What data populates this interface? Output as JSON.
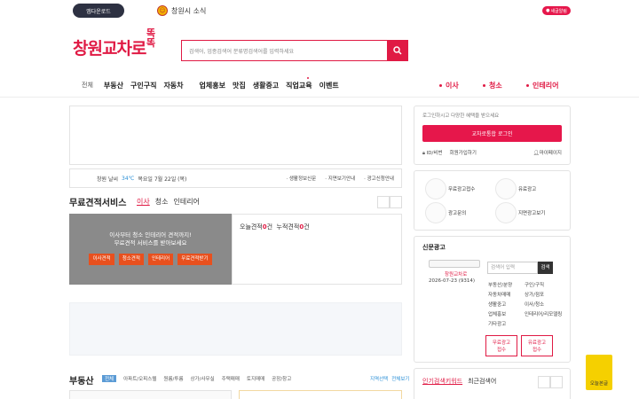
{
  "top": {
    "left_button": "앱다운로드",
    "promo_text": "창원시 소식",
    "right_pill": "새글알림"
  },
  "logo": {
    "main": "창원교차로",
    "badge_line1": "똑",
    "badge_line2": "똑"
  },
  "search": {
    "placeholder": "검색어, 업종검색어 분류명검색어를 입력하세요"
  },
  "nav": {
    "items": [
      "전체",
      "부동산",
      "구인구직",
      "자동차",
      "업체홍보",
      "맛집",
      "생활중고",
      "직업교육",
      "이벤트"
    ],
    "right": [
      "이사",
      "청소",
      "인테리어"
    ]
  },
  "weather": {
    "location": "창원 날씨",
    "temp": "34℃",
    "date": "목요일 7월 22일 (목)",
    "links": [
      "생활정보신문",
      "지면보기안내",
      "광고신청안내"
    ]
  },
  "quote": {
    "title": "무료견적서비스",
    "tabs": [
      "이사",
      "청소",
      "인테리어"
    ],
    "image_line1": "이사부터 청소 인테리어 견적까지!",
    "image_line2": "무료견적 서비스를 받아보세요",
    "image_buttons": [
      "이사견적",
      "청소견적",
      "인테리어",
      "무료견적받기"
    ],
    "count_label1": "오늘견적",
    "count_value1": "0",
    "count_unit1": "건",
    "count_label2": "누적견적",
    "count_value2": "0",
    "count_unit2": "건"
  },
  "realestate": {
    "title": "부동산",
    "tabs": [
      "전체",
      "아파트/오피스텔",
      "원룸/투룸",
      "상가/사무실",
      "주택매매",
      "토지매매",
      "공장/창고"
    ],
    "links": [
      "지역선택",
      "전체보기"
    ]
  },
  "login": {
    "hint": "로그인하시고 다양한 혜택을 받으세요",
    "button": "교차로통합 로그인",
    "find": "ID/비번",
    "signup": "회원가입하기",
    "mypage": "마이페이지"
  },
  "services": [
    "무료광고접수",
    "유료광고",
    "광고문의",
    "지면광고보기"
  ],
  "news": {
    "title": "신문광고",
    "paper_name": "창원교차로",
    "paper_date": "2026-07-23 (9314)",
    "search_placeholder": "검색어 입력",
    "search_btn": "검색",
    "cats_left": [
      "부동산/분양",
      "구인/구직",
      "자동차매매",
      "생활중고",
      "업체홍보",
      "기타광고"
    ],
    "cats_right": [
      "구인/구직",
      "상가/점포",
      "이사/청소",
      "인테리어/리모델링"
    ],
    "btn1_line1": "무료광고",
    "btn1_line2": "접수",
    "btn2_line1": "유료광고",
    "btn2_line2": "접수"
  },
  "bottom_card": {
    "active": "인기검색키워드",
    "other": "최근검색어"
  },
  "sticky": "오늘본글"
}
